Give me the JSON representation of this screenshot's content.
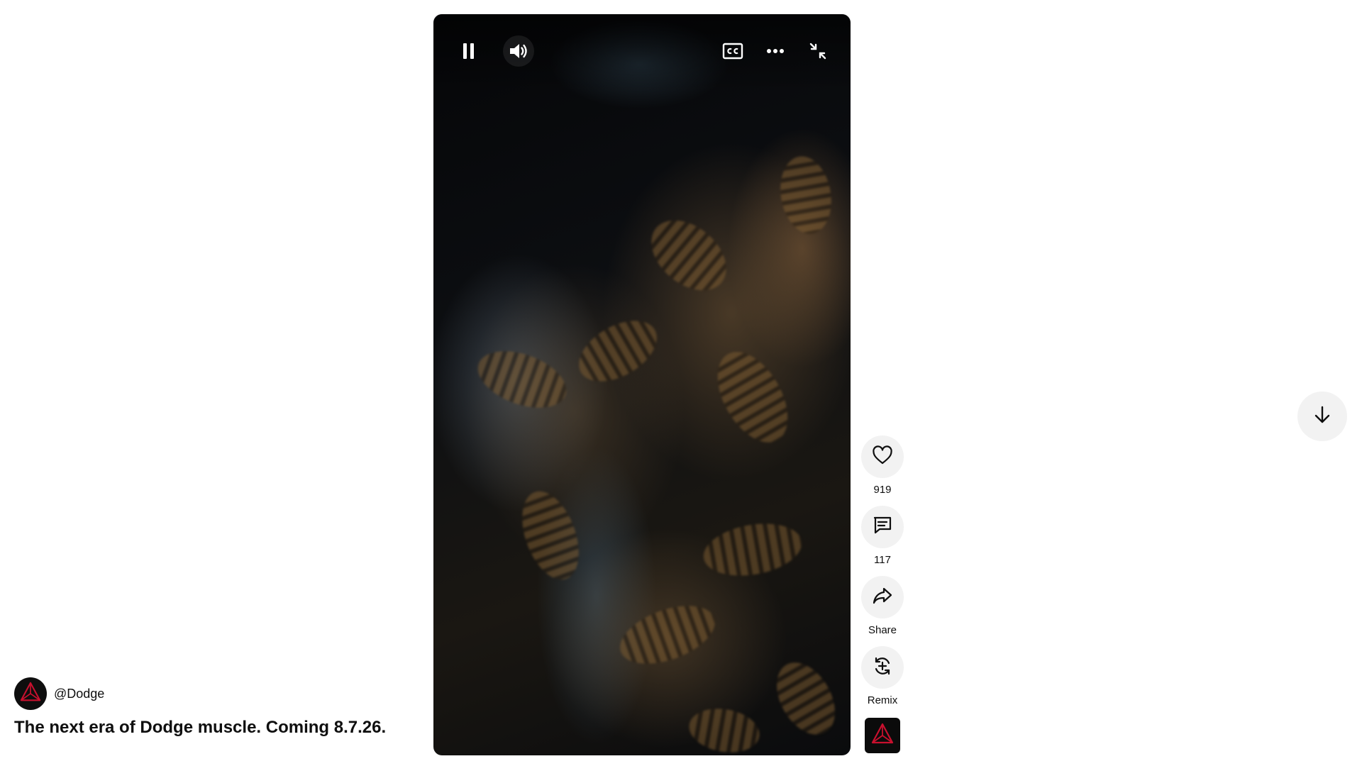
{
  "video": {
    "controls": {
      "pause_icon": "pause-icon",
      "volume_icon": "volume-icon",
      "captions_icon": "cc-icon",
      "more_icon": "more-horizontal-icon",
      "exit_fullscreen_icon": "collapse-icon"
    }
  },
  "actions": {
    "like": {
      "icon": "heart-icon",
      "label": "919"
    },
    "comment": {
      "icon": "comment-icon",
      "label": "117"
    },
    "share": {
      "icon": "share-arrow-icon",
      "label": "Share"
    },
    "remix": {
      "icon": "remix-icon",
      "label": "Remix"
    }
  },
  "channel": {
    "handle": "@Dodge"
  },
  "short": {
    "title": "The next era of Dodge muscle. Coming 8.7.26."
  },
  "navigation": {
    "next_icon": "arrow-down-icon"
  },
  "colors": {
    "brand_red": "#c8102e",
    "button_bg": "#f2f2f2",
    "text": "#0f0f0f"
  }
}
